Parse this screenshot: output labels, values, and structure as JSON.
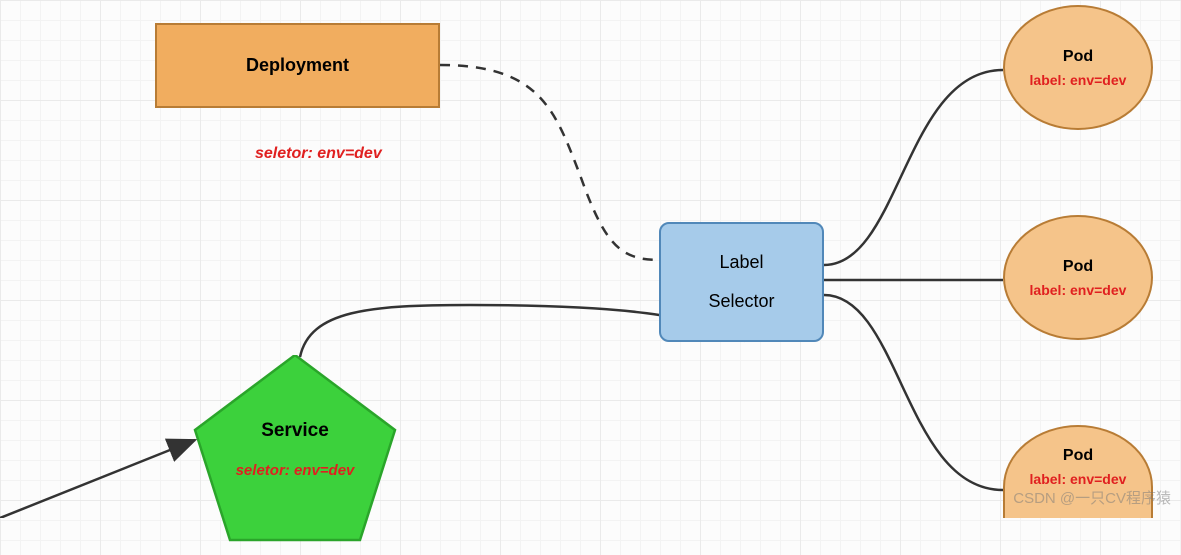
{
  "deployment": {
    "title": "Deployment",
    "selector_caption": "seletor:  env=dev"
  },
  "service": {
    "title": "Service",
    "selector_caption": "seletor:  env=dev"
  },
  "label_selector": {
    "line1": "Label",
    "line2": "Selector"
  },
  "pods": [
    {
      "title": "Pod",
      "label": "label: env=dev"
    },
    {
      "title": "Pod",
      "label": "label: env=dev"
    },
    {
      "title": "Pod",
      "label": "label: env=dev"
    }
  ],
  "watermark": "CSDN @一只CV程序猿",
  "colors": {
    "orange_fill": "#f1ad5f",
    "orange_stroke": "#b87c35",
    "blue_fill": "#a6cbea",
    "blue_stroke": "#5188b9",
    "green_fill": "#3cd13c",
    "green_stroke": "#2aa52a",
    "red_text": "#e02020"
  }
}
